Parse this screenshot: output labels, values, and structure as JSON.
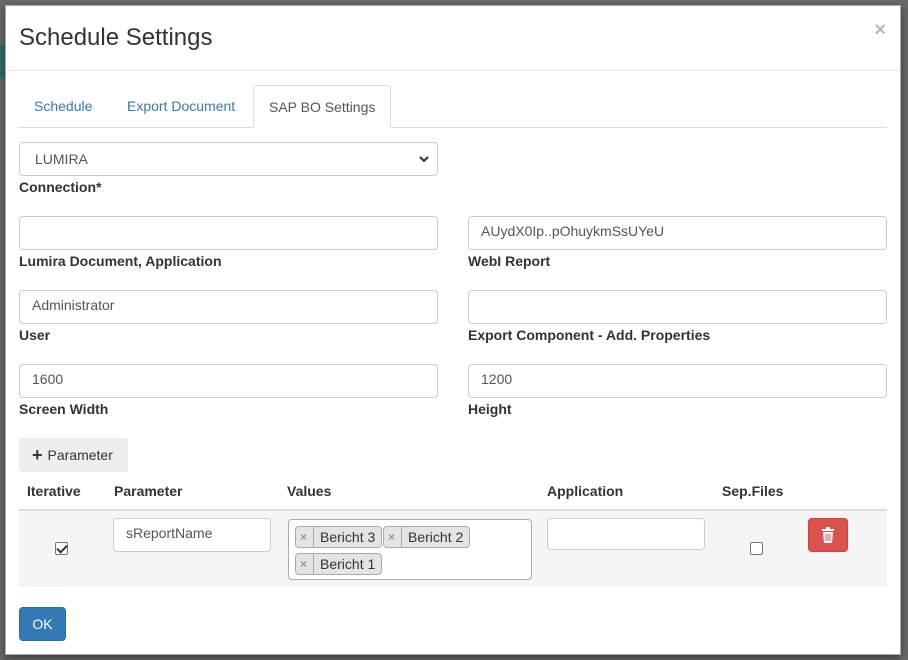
{
  "modal": {
    "title": "Schedule Settings",
    "close_symbol": "×"
  },
  "tabs": [
    {
      "label": "Schedule",
      "active": false
    },
    {
      "label": "Export Document",
      "active": false
    },
    {
      "label": "SAP BO Settings",
      "active": true
    }
  ],
  "form": {
    "connection": {
      "value": "LUMIRA",
      "label": "Connection*"
    },
    "lumira_document": {
      "value": "",
      "label": "Lumira Document, Application"
    },
    "webi_report": {
      "value": "AUydX0Ip..pOhuykmSsUYeU",
      "label": "WebI Report"
    },
    "user": {
      "value": "Administrator",
      "label": "User"
    },
    "export_component": {
      "value": "",
      "label": "Export Component - Add. Properties"
    },
    "screen_width": {
      "value": "1600",
      "label": "Screen Width"
    },
    "height": {
      "value": "1200",
      "label": "Height"
    }
  },
  "parameter_button": {
    "label": "Parameter",
    "icon": "plus-icon"
  },
  "parameter_table": {
    "columns": [
      "Iterative",
      "Parameter",
      "Values",
      "Application",
      "Sep.Files"
    ],
    "rows": [
      {
        "iterative": true,
        "parameter": "sReportName",
        "values": [
          "Bericht 3",
          "Bericht 2",
          "Bericht 1"
        ],
        "application": "",
        "sep_files": false
      }
    ]
  },
  "ok_button": {
    "label": "OK"
  },
  "colors": {
    "primary": "#337ab7",
    "danger": "#d9534f",
    "link": "#337ab7"
  },
  "tag_remove_symbol": "×"
}
